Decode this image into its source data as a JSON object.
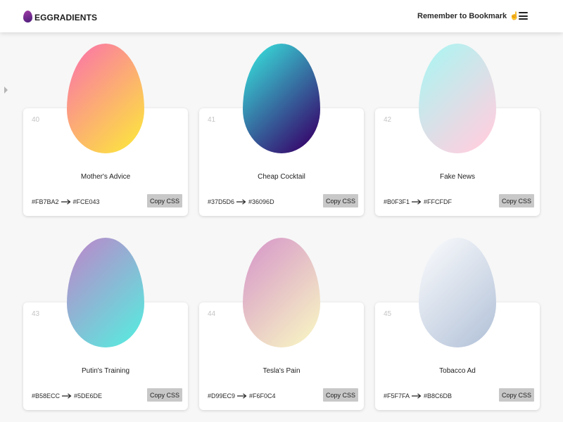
{
  "header": {
    "brand": "EGGRADIENTS",
    "bookmark_text": "Remember to Bookmark",
    "bookmark_emoji": "☝"
  },
  "cards": [
    {
      "number": "40",
      "title": "Mother's Advice",
      "from": "#FB7BA2",
      "to": "#FCE043",
      "copy_label": "Copy CSS"
    },
    {
      "number": "41",
      "title": "Cheap Cocktail",
      "from": "#37D5D6",
      "to": "#36096D",
      "copy_label": "Copy CSS"
    },
    {
      "number": "42",
      "title": "Fake News",
      "from": "#B0F3F1",
      "to": "#FFCFDF",
      "copy_label": "Copy CSS"
    },
    {
      "number": "43",
      "title": "Putin's Training",
      "from": "#B58ECC",
      "to": "#5DE6DE",
      "copy_label": "Copy CSS"
    },
    {
      "number": "44",
      "title": "Tesla's Pain",
      "from": "#D99EC9",
      "to": "#F6F0C4",
      "copy_label": "Copy CSS"
    },
    {
      "number": "45",
      "title": "Tobacco Ad",
      "from": "#F5F7FA",
      "to": "#B8C6DB",
      "copy_label": "Copy CSS"
    }
  ]
}
